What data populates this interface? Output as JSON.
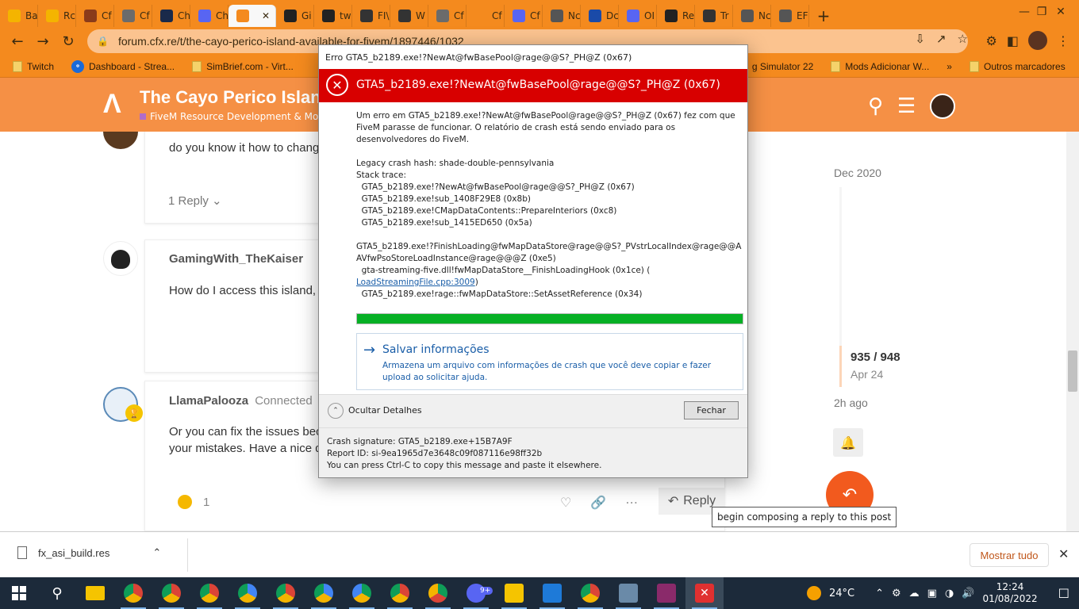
{
  "browser": {
    "tabs": [
      {
        "label": "Ba",
        "color": "#f4b400"
      },
      {
        "label": "Rc",
        "color": "#f4b400"
      },
      {
        "label": "Cf",
        "color": "#8a3b1a"
      },
      {
        "label": "Cf",
        "color": "#6b6b6b"
      },
      {
        "label": "Ch",
        "color": "#1a2a4a"
      },
      {
        "label": "Ch",
        "color": "#5865f2"
      },
      {
        "label": "",
        "color": "#f48a1e"
      },
      {
        "label": "Gi",
        "color": "#222222"
      },
      {
        "label": "tw",
        "color": "#222222"
      },
      {
        "label": "FI\\",
        "color": "#333333"
      },
      {
        "label": "W",
        "color": "#333333"
      },
      {
        "label": "Cf",
        "color": "#6b6b6b"
      },
      {
        "label": "Cf",
        "color": "#f48a1e"
      },
      {
        "label": "Cf",
        "color": "#5865f2"
      },
      {
        "label": "Nc",
        "color": "#555555"
      },
      {
        "label": "Dc",
        "color": "#1a4aa8"
      },
      {
        "label": "OI",
        "color": "#5865f2"
      },
      {
        "label": "Re",
        "color": "#222222"
      },
      {
        "label": "Tr",
        "color": "#333333"
      },
      {
        "label": "Nc",
        "color": "#555555"
      },
      {
        "label": "EF",
        "color": "#555555"
      }
    ],
    "new_tab_label": "+",
    "url": "forum.cfx.re/t/the-cayo-perico-island-available-for-fivem/1897446/1032",
    "bookmarks": [
      {
        "label": "Twitch"
      },
      {
        "label": "Dashboard - Strea..."
      },
      {
        "label": "SimBrief.com - Virt..."
      },
      {
        "label": "g Simulator 22"
      },
      {
        "label": "Mods Adicionar W..."
      }
    ],
    "bookmarks_more": "»",
    "other_bookmarks": "Outros marcadores"
  },
  "site": {
    "title": "The Cayo Perico Islan",
    "category": "FiveM Resource Development & Mod"
  },
  "posts": [
    {
      "text": "do you know it how to chang",
      "replies_label": "1 Reply"
    },
    {
      "username": "GamingWith_TheKaiser",
      "text": "How do I access this island,"
    },
    {
      "username": "LlamaPalooza",
      "status": "Connected",
      "text_line1": "Or you can fix the issues bec",
      "text_line2": "your mistakes. Have a nice d",
      "reaction_count": "1",
      "reply_label": "Reply"
    }
  ],
  "timeline": {
    "start_date": "Dec 2020",
    "position": "935 / 948",
    "position_date": "Apr 24",
    "end_label": "2h ago"
  },
  "tooltip": "begin composing a reply to this post",
  "dialog": {
    "window_title": "Erro GTA5_b2189.exe!?NewAt@fwBasePool@rage@@S?_PH@Z (0x67)",
    "header_title": "GTA5_b2189.exe!?NewAt@fwBasePool@rage@@S?_PH@Z (0x67)",
    "message": "Um erro em GTA5_b2189.exe!?NewAt@fwBasePool@rage@@S?_PH@Z (0x67) fez com que FiveM parasse de funcionar. O relatório de crash está sendo enviado para os desenvolvedores do FiveM.",
    "legacy_hash": "Legacy crash hash: shade-double-pennsylvania",
    "stack_trace_label": "Stack trace:",
    "trace_lines": [
      "  GTA5_b2189.exe!?NewAt@fwBasePool@rage@@S?_PH@Z (0x67)",
      "  GTA5_b2189.exe!sub_1408F29E8 (0x8b)",
      "  GTA5_b2189.exe!CMapDataContents::PrepareInteriors (0xc8)",
      "  GTA5_b2189.exe!sub_1415ED650 (0x5a)"
    ],
    "trace2_line1": "GTA5_b2189.exe!?FinishLoading@fwMapDataStore@rage@@S?_PVstrLocalIndex@rage@@A",
    "trace2_line2": "AVfwPsoStoreLoadInstance@rage@@@Z (0xe5)",
    "trace2_line3": "  gta-streaming-five.dll!fwMapDataStore__FinishLoadingHook (0x1ce) (",
    "trace2_link": "LoadStreamingFile.cpp:3009",
    "trace2_link_close": ")",
    "trace2_line4": "  GTA5_b2189.exe!rage::fwMapDataStore::SetAssetReference (0x34)",
    "progress": 1.0,
    "save_title": "Salvar informações",
    "save_desc": "Armazena um arquivo com informações de crash que você deve copiar e fazer upload ao solicitar ajuda.",
    "toggle_label": "Ocultar Detalhes",
    "close_label": "Fechar",
    "crash_signature": "Crash signature: GTA5_b2189.exe+15B7A9F",
    "report_id": "Report ID: si-9ea1965d7e3648c09f087116e98ff32b",
    "copy_hint": "You can press Ctrl-C to copy this message and paste it elsewhere."
  },
  "downloads": {
    "file_name": "fx_asi_build.res",
    "show_all": "Mostrar tudo"
  },
  "taskbar": {
    "weather": "24°C",
    "time": "12:24",
    "date": "01/08/2022",
    "badge": "9+"
  },
  "colors": {
    "brand_orange": "#f48a1e",
    "error_red": "#d80000",
    "progress_green": "#06b025",
    "link_blue": "#1a5ea8"
  }
}
